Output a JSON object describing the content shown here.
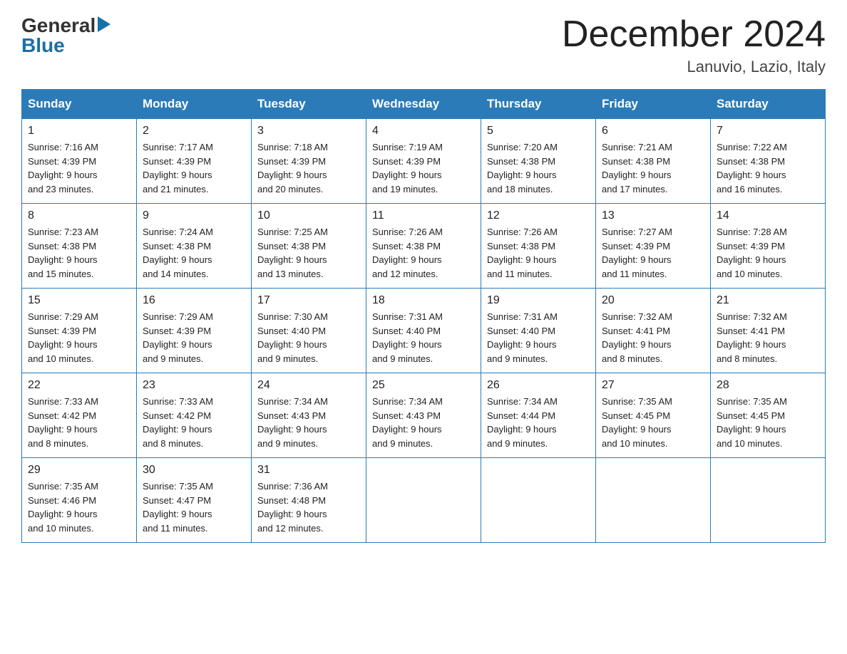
{
  "logo": {
    "line1": "General",
    "arrow": "▶",
    "line2": "Blue"
  },
  "title": {
    "month": "December 2024",
    "location": "Lanuvio, Lazio, Italy"
  },
  "days_of_week": [
    "Sunday",
    "Monday",
    "Tuesday",
    "Wednesday",
    "Thursday",
    "Friday",
    "Saturday"
  ],
  "weeks": [
    [
      {
        "day": "1",
        "sunrise": "7:16 AM",
        "sunset": "4:39 PM",
        "daylight": "9 hours and 23 minutes."
      },
      {
        "day": "2",
        "sunrise": "7:17 AM",
        "sunset": "4:39 PM",
        "daylight": "9 hours and 21 minutes."
      },
      {
        "day": "3",
        "sunrise": "7:18 AM",
        "sunset": "4:39 PM",
        "daylight": "9 hours and 20 minutes."
      },
      {
        "day": "4",
        "sunrise": "7:19 AM",
        "sunset": "4:39 PM",
        "daylight": "9 hours and 19 minutes."
      },
      {
        "day": "5",
        "sunrise": "7:20 AM",
        "sunset": "4:38 PM",
        "daylight": "9 hours and 18 minutes."
      },
      {
        "day": "6",
        "sunrise": "7:21 AM",
        "sunset": "4:38 PM",
        "daylight": "9 hours and 17 minutes."
      },
      {
        "day": "7",
        "sunrise": "7:22 AM",
        "sunset": "4:38 PM",
        "daylight": "9 hours and 16 minutes."
      }
    ],
    [
      {
        "day": "8",
        "sunrise": "7:23 AM",
        "sunset": "4:38 PM",
        "daylight": "9 hours and 15 minutes."
      },
      {
        "day": "9",
        "sunrise": "7:24 AM",
        "sunset": "4:38 PM",
        "daylight": "9 hours and 14 minutes."
      },
      {
        "day": "10",
        "sunrise": "7:25 AM",
        "sunset": "4:38 PM",
        "daylight": "9 hours and 13 minutes."
      },
      {
        "day": "11",
        "sunrise": "7:26 AM",
        "sunset": "4:38 PM",
        "daylight": "9 hours and 12 minutes."
      },
      {
        "day": "12",
        "sunrise": "7:26 AM",
        "sunset": "4:38 PM",
        "daylight": "9 hours and 11 minutes."
      },
      {
        "day": "13",
        "sunrise": "7:27 AM",
        "sunset": "4:39 PM",
        "daylight": "9 hours and 11 minutes."
      },
      {
        "day": "14",
        "sunrise": "7:28 AM",
        "sunset": "4:39 PM",
        "daylight": "9 hours and 10 minutes."
      }
    ],
    [
      {
        "day": "15",
        "sunrise": "7:29 AM",
        "sunset": "4:39 PM",
        "daylight": "9 hours and 10 minutes."
      },
      {
        "day": "16",
        "sunrise": "7:29 AM",
        "sunset": "4:39 PM",
        "daylight": "9 hours and 9 minutes."
      },
      {
        "day": "17",
        "sunrise": "7:30 AM",
        "sunset": "4:40 PM",
        "daylight": "9 hours and 9 minutes."
      },
      {
        "day": "18",
        "sunrise": "7:31 AM",
        "sunset": "4:40 PM",
        "daylight": "9 hours and 9 minutes."
      },
      {
        "day": "19",
        "sunrise": "7:31 AM",
        "sunset": "4:40 PM",
        "daylight": "9 hours and 9 minutes."
      },
      {
        "day": "20",
        "sunrise": "7:32 AM",
        "sunset": "4:41 PM",
        "daylight": "9 hours and 8 minutes."
      },
      {
        "day": "21",
        "sunrise": "7:32 AM",
        "sunset": "4:41 PM",
        "daylight": "9 hours and 8 minutes."
      }
    ],
    [
      {
        "day": "22",
        "sunrise": "7:33 AM",
        "sunset": "4:42 PM",
        "daylight": "9 hours and 8 minutes."
      },
      {
        "day": "23",
        "sunrise": "7:33 AM",
        "sunset": "4:42 PM",
        "daylight": "9 hours and 8 minutes."
      },
      {
        "day": "24",
        "sunrise": "7:34 AM",
        "sunset": "4:43 PM",
        "daylight": "9 hours and 9 minutes."
      },
      {
        "day": "25",
        "sunrise": "7:34 AM",
        "sunset": "4:43 PM",
        "daylight": "9 hours and 9 minutes."
      },
      {
        "day": "26",
        "sunrise": "7:34 AM",
        "sunset": "4:44 PM",
        "daylight": "9 hours and 9 minutes."
      },
      {
        "day": "27",
        "sunrise": "7:35 AM",
        "sunset": "4:45 PM",
        "daylight": "9 hours and 10 minutes."
      },
      {
        "day": "28",
        "sunrise": "7:35 AM",
        "sunset": "4:45 PM",
        "daylight": "9 hours and 10 minutes."
      }
    ],
    [
      {
        "day": "29",
        "sunrise": "7:35 AM",
        "sunset": "4:46 PM",
        "daylight": "9 hours and 10 minutes."
      },
      {
        "day": "30",
        "sunrise": "7:35 AM",
        "sunset": "4:47 PM",
        "daylight": "9 hours and 11 minutes."
      },
      {
        "day": "31",
        "sunrise": "7:36 AM",
        "sunset": "4:48 PM",
        "daylight": "9 hours and 12 minutes."
      },
      null,
      null,
      null,
      null
    ]
  ]
}
